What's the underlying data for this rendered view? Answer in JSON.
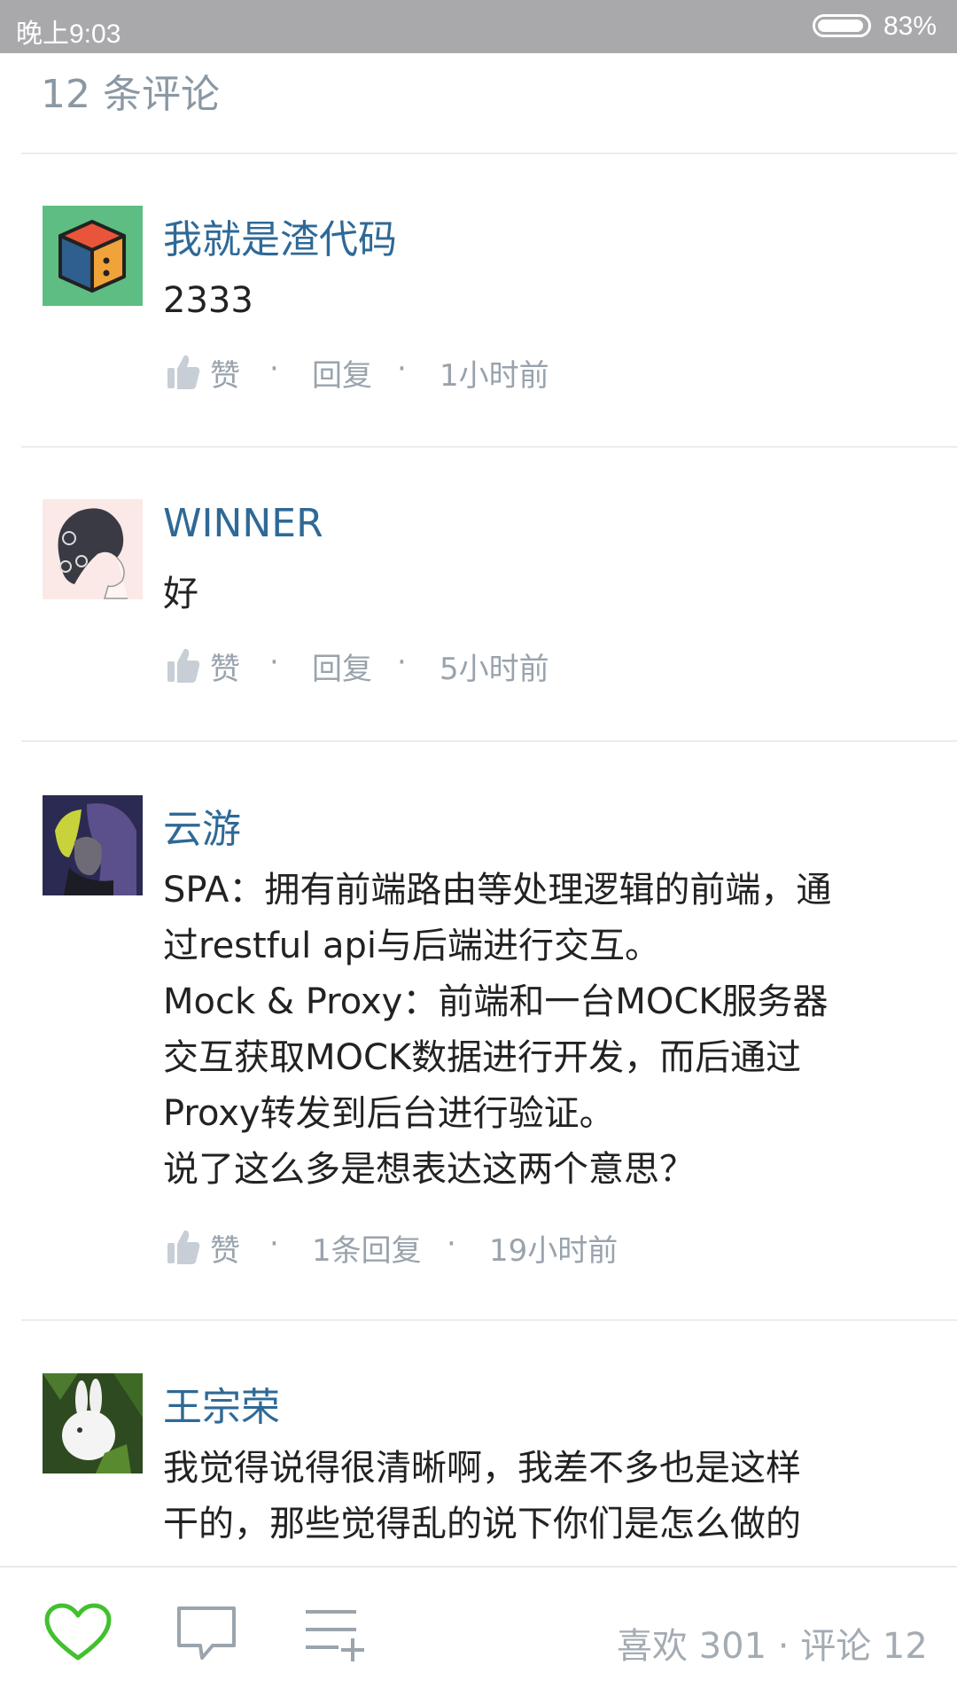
{
  "status_bar": {
    "time": "晚上9:03",
    "battery": "83%"
  },
  "header": {
    "comment_count": "12 条评论"
  },
  "comments": [
    {
      "author": "我就是渣代码",
      "body": [
        "2333"
      ],
      "like_label": "赞",
      "reply_label": "回复",
      "time": "1小时前",
      "avatar_icon": "cube-avatar-icon"
    },
    {
      "author": "WINNER",
      "body": [
        "好"
      ],
      "like_label": "赞",
      "reply_label": "回复",
      "time": "5小时前",
      "avatar_icon": "sketch-portrait-avatar"
    },
    {
      "author": "云游",
      "body": [
        "SPA：拥有前端路由等处理逻辑的前端，通",
        "过restful api与后端进行交互。",
        "Mock & Proxy：前端和一台MOCK服务器",
        "交互获取MOCK数据进行开发，而后通过",
        "Proxy转发到后台进行验证。",
        "说了这么多是想表达这两个意思？"
      ],
      "like_label": "赞",
      "reply_label": "1条回复",
      "time": "19小时前",
      "avatar_icon": "anime-character-avatar"
    },
    {
      "author": "王宗荣",
      "body": [
        "我觉得说得很清晰啊，我差不多也是这样",
        "干的，那些觉得乱的说下你们是怎么做的"
      ],
      "avatar_icon": "rabbit-avatar"
    }
  ],
  "separator": "·",
  "bottom_bar": {
    "stats": "喜欢 301 · 评论 12",
    "icons": [
      "heart-icon",
      "comment-icon",
      "add-to-list-icon"
    ]
  },
  "colors": {
    "status_bar": "#a9a9ab",
    "author": "#2f6996",
    "meta": "#99a3ad",
    "heart": "#42c02e"
  }
}
